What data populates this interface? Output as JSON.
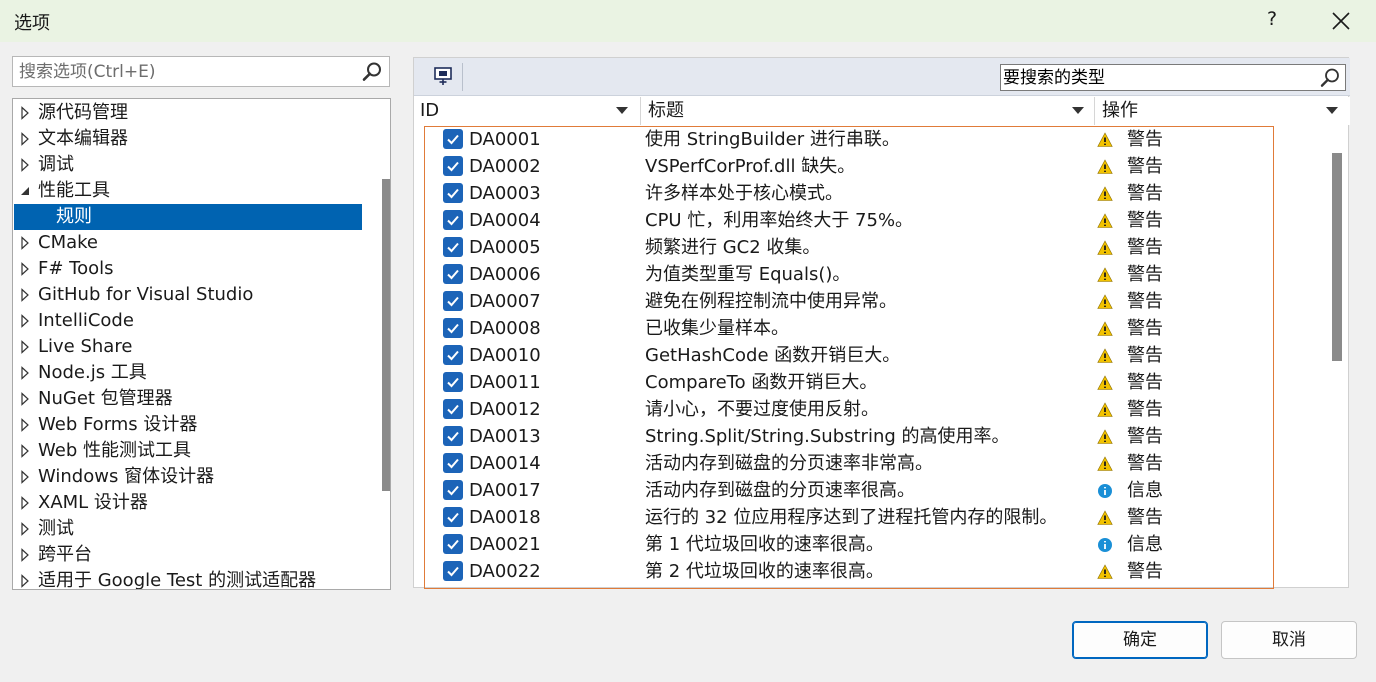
{
  "window": {
    "title": "选项",
    "help": "?"
  },
  "search": {
    "placeholder": "搜索选项(Ctrl+E)"
  },
  "tree": {
    "items": [
      {
        "label": "源代码管理",
        "expanded": false
      },
      {
        "label": "文本编辑器",
        "expanded": false
      },
      {
        "label": "调试",
        "expanded": false
      },
      {
        "label": "性能工具",
        "expanded": true
      },
      {
        "label": "规则",
        "child": true,
        "selected": true
      },
      {
        "label": "CMake",
        "expanded": false
      },
      {
        "label": "F# Tools",
        "expanded": false
      },
      {
        "label": "GitHub for Visual Studio",
        "expanded": false
      },
      {
        "label": "IntelliCode",
        "expanded": false
      },
      {
        "label": "Live Share",
        "expanded": false
      },
      {
        "label": "Node.js 工具",
        "expanded": false
      },
      {
        "label": "NuGet 包管理器",
        "expanded": false
      },
      {
        "label": "Web Forms 设计器",
        "expanded": false
      },
      {
        "label": "Web 性能测试工具",
        "expanded": false
      },
      {
        "label": "Windows 窗体设计器",
        "expanded": false
      },
      {
        "label": "XAML 设计器",
        "expanded": false
      },
      {
        "label": "测试",
        "expanded": false
      },
      {
        "label": "跨平台",
        "expanded": false
      },
      {
        "label": "适用于 Google Test 的测试适配器",
        "expanded": false
      }
    ]
  },
  "rules_panel": {
    "type_search": {
      "placeholder": "要搜索的类型"
    },
    "columns": {
      "id": "ID",
      "title": "标题",
      "action": "操作"
    },
    "rows": [
      {
        "id": "DA0001",
        "title": "使用 StringBuilder 进行串联。",
        "severity": "警告",
        "icon": "warning-icon",
        "checked": true
      },
      {
        "id": "DA0002",
        "title": "VSPerfCorProf.dll 缺失。",
        "severity": "警告",
        "icon": "warning-icon",
        "checked": true
      },
      {
        "id": "DA0003",
        "title": "许多样本处于核心模式。",
        "severity": "警告",
        "icon": "warning-icon",
        "checked": true
      },
      {
        "id": "DA0004",
        "title": "CPU 忙，利用率始终大于 75%。",
        "severity": "警告",
        "icon": "warning-icon",
        "checked": true
      },
      {
        "id": "DA0005",
        "title": "频繁进行 GC2 收集。",
        "severity": "警告",
        "icon": "warning-icon",
        "checked": true
      },
      {
        "id": "DA0006",
        "title": "为值类型重写 Equals()。",
        "severity": "警告",
        "icon": "warning-icon",
        "checked": true
      },
      {
        "id": "DA0007",
        "title": "避免在例程控制流中使用异常。",
        "severity": "警告",
        "icon": "warning-icon",
        "checked": true
      },
      {
        "id": "DA0008",
        "title": "已收集少量样本。",
        "severity": "警告",
        "icon": "warning-icon",
        "checked": true
      },
      {
        "id": "DA0010",
        "title": "GetHashCode 函数开销巨大。",
        "severity": "警告",
        "icon": "warning-icon",
        "checked": true
      },
      {
        "id": "DA0011",
        "title": "CompareTo 函数开销巨大。",
        "severity": "警告",
        "icon": "warning-icon",
        "checked": true
      },
      {
        "id": "DA0012",
        "title": "请小心，不要过度使用反射。",
        "severity": "警告",
        "icon": "warning-icon",
        "checked": true
      },
      {
        "id": "DA0013",
        "title": "String.Split/String.Substring 的高使用率。",
        "severity": "警告",
        "icon": "warning-icon",
        "checked": true
      },
      {
        "id": "DA0014",
        "title": "活动内存到磁盘的分页速率非常高。",
        "severity": "警告",
        "icon": "warning-icon",
        "checked": true
      },
      {
        "id": "DA0017",
        "title": "活动内存到磁盘的分页速率很高。",
        "severity": "信息",
        "icon": "info-icon",
        "checked": true
      },
      {
        "id": "DA0018",
        "title": "运行的 32 位应用程序达到了进程托管内存的限制。",
        "severity": "警告",
        "icon": "warning-icon",
        "checked": true
      },
      {
        "id": "DA0021",
        "title": "第 1 代垃圾回收的速率很高。",
        "severity": "信息",
        "icon": "info-icon",
        "checked": true
      },
      {
        "id": "DA0022",
        "title": "第 2 代垃圾回收的速率很高。",
        "severity": "警告",
        "icon": "warning-icon",
        "checked": true
      }
    ]
  },
  "buttons": {
    "ok": "确定",
    "cancel": "取消"
  },
  "colors": {
    "selection": "#0063b1",
    "checkbox": "#1c64b8",
    "grid_border": "#e07b39",
    "warning": "#f2c200",
    "info": "#1a8fd6"
  }
}
